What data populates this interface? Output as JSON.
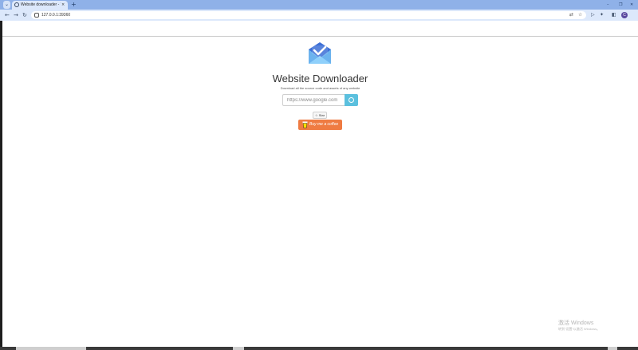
{
  "browser": {
    "tab_title": "Website downloader - Take",
    "tab_close": "×",
    "new_tab": "+",
    "url": "127.0.0.1:39360",
    "profile_initial": "C",
    "window_controls": {
      "minimize": "–",
      "restore": "❐",
      "close": "✕"
    }
  },
  "page": {
    "heading": "Website Downloader",
    "subtitle": "Download all the source code and assets of any website",
    "url_placeholder": "https://www.google.com",
    "star_label": "Star",
    "coffee_label": "Buy me a coffee"
  },
  "os": {
    "watermark_title": "激活 Windows",
    "watermark_sub": "转到\"设置\"以激活 Windows。"
  },
  "colors": {
    "browser_accent": "#8fb1e8",
    "toolbar": "#dce8fb",
    "go_button": "#5bc0de",
    "coffee_button": "#ef7b42"
  },
  "icons": [
    "tab-search-icon",
    "page-favicon-icon",
    "back-arrow-icon",
    "forward-arrow-icon",
    "reload-icon",
    "site-info-icon",
    "translate-icon",
    "bookmark-star-icon",
    "media-icon",
    "extensions-icon",
    "sidebar-icon",
    "envelope-check-logo-icon",
    "download-go-icon",
    "star-icon",
    "coffee-cup-icon"
  ]
}
